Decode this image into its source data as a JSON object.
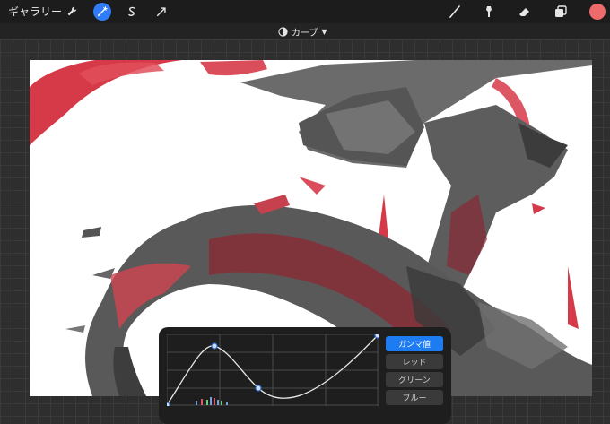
{
  "topbar": {
    "gallery_label": "ギャラリー",
    "left_tools": [
      "wrench-icon",
      "magic-wand-icon",
      "selection-s-icon",
      "arrow-transform-icon"
    ],
    "right_tools": [
      "brush-icon",
      "smudge-icon",
      "eraser-icon",
      "layers-icon"
    ],
    "active_tool": "magic-wand-icon",
    "current_color": "#ef6a6a"
  },
  "adjustment": {
    "title": "カーブ"
  },
  "curves_panel": {
    "channels": [
      {
        "label": "ガンマ値",
        "active": true
      },
      {
        "label": "レッド",
        "active": false
      },
      {
        "label": "グリーン",
        "active": false
      },
      {
        "label": "ブルー",
        "active": false
      }
    ]
  },
  "colors": {
    "accent": "#1e7cf2",
    "art_red": "#d63a48",
    "art_gray": "#5a5a5a"
  }
}
